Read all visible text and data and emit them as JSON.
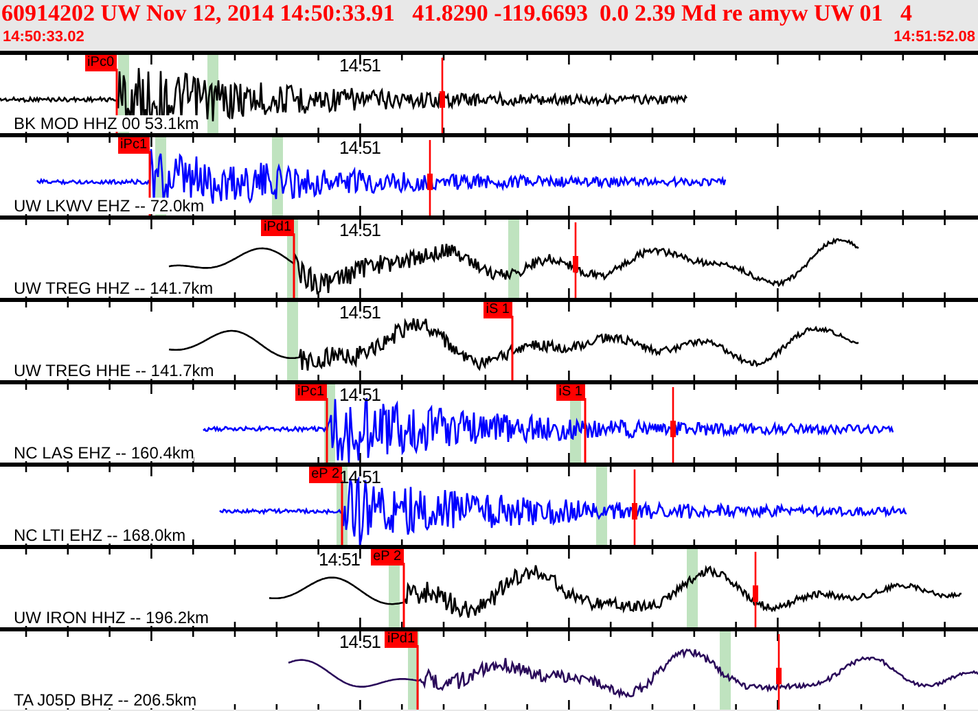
{
  "header": {
    "event_line": "60914202 UW Nov 12, 2014 14:50:33.91   41.8290 -119.6693  0.0 2.39 Md re amyw UW 01   4",
    "start_time": "14:50:33.02",
    "end_time": "14:51:52.08"
  },
  "traces": [
    {
      "label": "BK MOD HHZ 00 53.1km",
      "time_label": "14:51",
      "color": "#000000",
      "picks": [
        {
          "label": "iPc0"
        }
      ]
    },
    {
      "label": "UW LKWV EHZ -- 72.0km",
      "time_label": "14:51",
      "color": "#0000ff",
      "picks": [
        {
          "label": "iPc1"
        }
      ]
    },
    {
      "label": "UW TREG HHZ -- 141.7km",
      "time_label": "14:51",
      "color": "#000000",
      "picks": [
        {
          "label": "iPd1"
        }
      ]
    },
    {
      "label": "UW TREG HHE -- 141.7km",
      "time_label": "14:51",
      "color": "#000000",
      "picks": [
        {
          "label": "iS 1"
        }
      ]
    },
    {
      "label": "NC LAS EHZ -- 160.4km",
      "time_label": "14:51",
      "color": "#0000ff",
      "picks": [
        {
          "label": "iPc1"
        },
        {
          "label": "iS 1"
        }
      ]
    },
    {
      "label": "NC LTI EHZ -- 168.0km",
      "time_label": "14:51",
      "color": "#0000ff",
      "picks": [
        {
          "label": "eP 2"
        }
      ]
    },
    {
      "label": "UW IRON HHZ -- 196.2km",
      "time_label": "14:51",
      "color": "#000000",
      "picks": [
        {
          "label": "eP 2"
        }
      ]
    },
    {
      "label": "TA J05D BHZ -- 206.5km",
      "time_label": "14:51",
      "color": "#2a0a5a",
      "picks": [
        {
          "label": "iPd1"
        }
      ]
    }
  ]
}
